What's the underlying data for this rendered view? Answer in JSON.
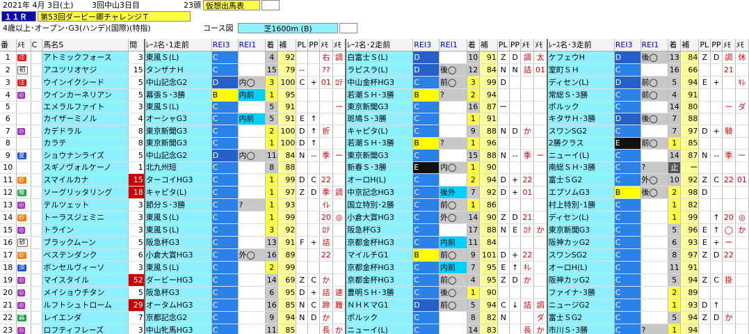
{
  "header": {
    "date": "2021年 4月 3日(土)",
    "meeting": "3回中山3日目",
    "race_no": "１１Ｒ",
    "race_name": "第53回ダービー卿チャレンジＴ",
    "field": "23頭",
    "mode": "仮想出馬表",
    "cond": "4歳以上･オープン･G3(ハンデ)(国際)(特指)",
    "course_label": "コース図",
    "course": "芝1600m (B)"
  },
  "columns": [
    "番",
    "ﾒﾓ",
    "C",
    "馬名S",
    "間",
    "ﾚｰｽ名･1走前",
    "REI3",
    "REI1",
    "着",
    "補",
    "PL",
    "PP",
    "ﾒﾓ",
    "ﾒﾓ",
    "ﾚｰｽ名･2走前",
    "REI3",
    "REI1",
    "着",
    "補",
    "PL",
    "PP",
    "ﾒﾓ",
    "ﾒﾓ",
    "ﾚｰｽ名･3走前",
    "REI3",
    "REI1",
    "着",
    "補",
    "PL",
    "PP",
    "ﾒﾓ",
    "ﾒﾓ"
  ],
  "colors": {
    "cyan": "#8ff0ff",
    "class_C": "#2a82e8",
    "class_B": "#ffff00",
    "red_mark": "#e00000"
  },
  "rows": [
    {
      "no": "1",
      "memo": "",
      "mk": "注",
      "mkc": "red",
      "name": "アトミックフォース",
      "iv": "3",
      "iv_hl": false,
      "r": [
        {
          "n": "東風Ｓ(L)",
          "g": "C",
          "s": "",
          "f": "4",
          "h": "92",
          "pl": "",
          "pp": "",
          "m1": "右",
          "m2": "調"
        },
        {
          "n": "白富士Ｓ(L)",
          "g": "D",
          "s": "",
          "f": "10",
          "h": "91",
          "pl": "Z",
          "pp": "D",
          "m1": "調",
          "m2": "太"
        },
        {
          "n": "ケフェウH",
          "g": "D",
          "s": "後◯",
          "f": "13",
          "h": "84",
          "pl": "Z",
          "pp": "D",
          "m1": "調",
          "m2": "休"
        }
      ]
    },
    {
      "no": "2",
      "memo": "",
      "mk": "初",
      "mkc": "wht",
      "name": "アユツリオヤジ",
      "iv": "15",
      "iv_hl": false,
      "r": [
        {
          "n": "タンザナＨ",
          "g": "C",
          "s": "",
          "f": "15",
          "h": "79",
          "pl": "--",
          "pp": "",
          "m1": "??",
          "m2": ""
        },
        {
          "n": "ラピスラ(L)",
          "g": "D",
          "s": "後◯",
          "f": "12",
          "h": "84",
          "pl": "N",
          "pp": "N",
          "m1": "詰",
          "m2": "01"
        },
        {
          "n": "室町ＳＨ",
          "g": "C",
          "s": "",
          "f": "16",
          "h": "66",
          "pl": "",
          "pp": "",
          "m1": "21",
          "m2": ""
        }
      ]
    },
    {
      "no": "3",
      "memo": "",
      "mk": "注",
      "mkc": "red",
      "name": "ウインイクシード",
      "iv": "5",
      "iv_hl": false,
      "r": [
        {
          "n": "中山記念G2",
          "g": "D",
          "s": "内◯",
          "f": "3",
          "h": "100",
          "pl": "C",
          "pp": "+",
          "m1": "01",
          "m2": "ﾛﾃ"
        },
        {
          "n": "中山金杯HG3",
          "g": "C",
          "s": "前◯",
          "f": "3",
          "h": "99",
          "pl": "D",
          "pp": "",
          "m1": "",
          "m2": ""
        },
        {
          "n": "ディセン(L)",
          "g": "D",
          "s": "前◯",
          "f": "5",
          "h": "94",
          "pl": "E",
          "pp": "+",
          "m1": "",
          "m2": "ｷﾚ"
        }
      ]
    },
    {
      "no": "4",
      "memo": "",
      "mk": "◎",
      "mkc": "pur",
      "name": "ウインカーネリアン",
      "iv": "5",
      "iv_hl": false,
      "r": [
        {
          "n": "幕張Ｓ･3勝",
          "g": "B",
          "s": "内前",
          "f": "1",
          "h": "95",
          "pl": "",
          "pp": "",
          "m1": "",
          "m2": ""
        },
        {
          "n": "若潮ＳＨ･3勝",
          "g": "B",
          "s": "?",
          "f": "2",
          "h": "94",
          "pl": "",
          "pp": "",
          "m1": "",
          "m2": ""
        },
        {
          "n": "常総Ｓ･3勝",
          "g": "C",
          "s": "前◯",
          "f": "4",
          "h": "91",
          "pl": "",
          "pp": "",
          "m1": "",
          "m2": ""
        }
      ]
    },
    {
      "no": "5",
      "memo": "",
      "mk": "",
      "mkc": "",
      "name": "エメラルファイト",
      "iv": "3",
      "iv_hl": false,
      "r": [
        {
          "n": "東風Ｓ(L)",
          "g": "C",
          "s": "",
          "f": "5",
          "h": "91",
          "pl": "",
          "pp": "",
          "m1": "",
          "m2": "ー"
        },
        {
          "n": "東京新聞G3",
          "g": "C",
          "s": "",
          "f": "16",
          "h": "87",
          "pl": "ー",
          "pp": "",
          "m1": "",
          "m2": ""
        },
        {
          "n": "ポルック",
          "g": "C",
          "s": "",
          "f": "14",
          "h": "80",
          "pl": "",
          "pp": "",
          "m1": "ー",
          "m2": "ダ"
        }
      ]
    },
    {
      "no": "6",
      "memo": "",
      "mk": "",
      "mkc": "",
      "name": "カイザーミノル",
      "iv": "4",
      "iv_hl": false,
      "r": [
        {
          "n": "オーシャG3",
          "g": "C",
          "s": "内前",
          "f": "5",
          "h": "91",
          "pl": "E",
          "pp": "↑",
          "m1": "",
          "m2": ""
        },
        {
          "n": "斑鳩Ｓ･3勝",
          "g": "C",
          "s": "",
          "f": "1",
          "h": "91",
          "pl": "",
          "pp": "",
          "m1": "",
          "m2": ""
        },
        {
          "n": "キタサＨ･3勝",
          "g": "D",
          "s": "後◯",
          "f": "7",
          "h": "88",
          "pl": "",
          "pp": "",
          "m1": "",
          "m2": ""
        }
      ]
    },
    {
      "no": "7",
      "memo": "",
      "mk": "◎",
      "mkc": "pur",
      "name": "カデドラル",
      "iv": "8",
      "iv_hl": false,
      "r": [
        {
          "n": "東京新聞G3",
          "g": "C",
          "s": "",
          "f": "2",
          "h": "100",
          "pl": "D",
          "pp": "↑",
          "m1": "折",
          "m2": ""
        },
        {
          "n": "キャピタ(L)",
          "g": "C",
          "s": "",
          "f": "9",
          "h": "88",
          "pl": "N",
          "pp": "D",
          "m1": "か",
          "m2": ""
        },
        {
          "n": "スワンSG2",
          "g": "C",
          "s": "",
          "f": "7",
          "h": "97",
          "pl": "D",
          "pp": "+",
          "m1": "騎",
          "m2": ""
        }
      ]
    },
    {
      "no": "8",
      "memo": "",
      "mk": "",
      "mkc": "",
      "name": "カラテ",
      "iv": "8",
      "iv_hl": false,
      "r": [
        {
          "n": "東京新聞G3",
          "g": "C",
          "s": "",
          "f": "1",
          "h": "100",
          "pl": "D",
          "pp": "↑",
          "m1": "",
          "m2": ""
        },
        {
          "n": "若潮ＳＨ･3勝",
          "g": "B",
          "s": "?",
          "f": "1",
          "h": "96",
          "pl": "",
          "pp": "",
          "m1": "",
          "m2": ""
        },
        {
          "n": "2勝クラス",
          "g": "E",
          "s": "前◯",
          "f": "1",
          "h": "85",
          "pl": "",
          "pp": "",
          "m1": "",
          "m2": ""
        }
      ]
    },
    {
      "no": "9",
      "memo": "",
      "mk": "夏",
      "mkc": "blu",
      "name": "ショウナンライズ",
      "iv": "5",
      "iv_hl": false,
      "r": [
        {
          "n": "中山記念G2",
          "g": "D",
          "s": "内◯",
          "f": "11",
          "h": "84",
          "pl": "N",
          "pp": "--",
          "m1": "季",
          "m2": "ー"
        },
        {
          "n": "東京新聞G3",
          "g": "C",
          "s": "",
          "f": "15",
          "h": "88",
          "pl": "N",
          "pp": "--",
          "m1": "季",
          "m2": "ー"
        },
        {
          "n": "ニューイ(L)",
          "g": "C",
          "s": "",
          "f": "14",
          "h": "87",
          "pl": "N",
          "pp": "--",
          "m1": "季",
          "m2": "ー"
        }
      ]
    },
    {
      "no": "10",
      "memo": "",
      "mk": "",
      "mkc": "",
      "name": "スギノヴォルケーノ",
      "iv": "1",
      "iv_hl": false,
      "r": [
        {
          "n": "北九州短",
          "g": "C",
          "s": "",
          "f": "8",
          "h": "88",
          "pl": "",
          "pp": "",
          "m1": "",
          "m2": ""
        },
        {
          "n": "新春Ｓ･3勝",
          "g": "E",
          "s": "内◯",
          "f": "1",
          "h": "90",
          "pl": "",
          "pp": "",
          "m1": "",
          "m2": ""
        },
        {
          "n": "南総ＳＨ･3勝",
          "g": "C",
          "s": "?",
          "f": "止",
          "h": "ー",
          "pl": "",
          "pp": "",
          "m1": "",
          "m2": ""
        }
      ]
    },
    {
      "no": "11",
      "memo": "",
      "mk": "砂",
      "mkc": "org",
      "name": "スマイルカナ",
      "iv": "15",
      "iv_hl": true,
      "r": [
        {
          "n": "ターコイHG3",
          "g": "C",
          "s": "",
          "f": "1",
          "h": "99",
          "pl": "D",
          "pp": "C",
          "m1": "22",
          "m2": ""
        },
        {
          "n": "オーロH(L)",
          "g": "C",
          "s": "",
          "f": "2",
          "h": "94",
          "pl": "D",
          "pp": "+",
          "m1": "22",
          "m2": ""
        },
        {
          "n": "富士ＳG2",
          "g": "C",
          "s": "外◯",
          "f": "10",
          "h": "92",
          "pl": "Z",
          "pp": "C",
          "m1": "22",
          "m2": "01"
        }
      ]
    },
    {
      "no": "12",
      "memo": "",
      "mk": "暖",
      "mkc": "grn",
      "name": "ソーグリッタリング",
      "iv": "18",
      "iv_hl": true,
      "r": [
        {
          "n": "キャピタ(L)",
          "g": "C",
          "s": "",
          "f": "1",
          "h": "97",
          "pl": "Z",
          "pp": "D",
          "m1": "季",
          "m2": "調"
        },
        {
          "n": "中京記念HG3",
          "g": "C",
          "s": "後外",
          "f": "7",
          "h": "92",
          "pl": "D",
          "pp": "+",
          "m1": "01",
          "m2": ""
        },
        {
          "n": "エプソムG3",
          "g": "B",
          "s": "後◯",
          "f": "2",
          "h": "98",
          "pl": "D",
          "pp": "",
          "m1": "",
          "m2": ""
        }
      ]
    },
    {
      "no": "13",
      "memo": "",
      "mk": "◎",
      "mkc": "pur",
      "name": "テルツェット",
      "iv": "3",
      "iv_hl": false,
      "r": [
        {
          "n": "節分Ｓ･3勝",
          "g": "C",
          "s": "?",
          "f": "1",
          "h": "93",
          "pl": "",
          "pp": "",
          "m1": "ｲﾚ",
          "m2": ""
        },
        {
          "n": "国立特別･2勝",
          "g": "C",
          "s": "前◯",
          "f": "1",
          "h": "86",
          "pl": "",
          "pp": "",
          "m1": "",
          "m2": ""
        },
        {
          "n": "村上特別･1勝",
          "g": "C",
          "s": "",
          "f": "1",
          "h": "82",
          "pl": "",
          "pp": "",
          "m1": "",
          "m2": ""
        }
      ]
    },
    {
      "no": "14",
      "memo": "",
      "mk": "砂",
      "mkc": "org",
      "name": "トーラスジェミニ",
      "iv": "3",
      "iv_hl": false,
      "r": [
        {
          "n": "東風Ｓ(L)",
          "g": "C",
          "s": "",
          "f": "1",
          "h": "99",
          "pl": "",
          "pp": "",
          "m1": "20",
          "m2": "◎"
        },
        {
          "n": "小倉大賞HG3",
          "g": "C",
          "s": "外◯",
          "f": "14",
          "h": "90",
          "pl": "Z",
          "pp": "D",
          "m1": "21",
          "m2": ""
        },
        {
          "n": "ディセン(L)",
          "g": "C",
          "s": "",
          "f": "1",
          "h": "99",
          "pl": "",
          "pp": "↑",
          "m1": "20",
          "m2": "◎"
        }
      ]
    },
    {
      "no": "15",
      "memo": "",
      "mk": "◎",
      "mkc": "pur",
      "name": "トライン",
      "iv": "3",
      "iv_hl": false,
      "r": [
        {
          "n": "東風Ｓ(L)",
          "g": "C",
          "s": "",
          "f": "3",
          "h": "92",
          "pl": "",
          "pp": "",
          "m1": "ﾛﾃ",
          "m2": ""
        },
        {
          "n": "阪急杯G3",
          "g": "C",
          "s": "",
          "f": "17",
          "h": "88",
          "pl": "N",
          "pp": "E",
          "m1": "ﾛﾃ",
          "m2": "か"
        },
        {
          "n": "東京新聞G3",
          "g": "C",
          "s": "",
          "f": "5",
          "h": "96",
          "pl": "E",
          "pp": "↑",
          "m1": "◯",
          "m2": "か"
        }
      ]
    },
    {
      "no": "16",
      "memo": "",
      "mk": "砂",
      "mkc": "wht",
      "name": "ブラックムーン",
      "iv": "5",
      "iv_hl": false,
      "r": [
        {
          "n": "阪急杯G3",
          "g": "C",
          "s": "",
          "f": "13",
          "h": "91",
          "pl": "F",
          "pp": "+",
          "m1": "詰",
          "m2": ""
        },
        {
          "n": "京都金杯HG3",
          "g": "C",
          "s": "内前",
          "f": "11",
          "h": "84",
          "pl": "",
          "pp": "",
          "m1": "",
          "m2": ""
        },
        {
          "n": "阪神カッG2",
          "g": "C",
          "s": "",
          "f": "6",
          "h": "93",
          "pl": "E",
          "pp": "+",
          "m1": "ー",
          "m2": ""
        }
      ]
    },
    {
      "no": "17",
      "memo": "",
      "mk": "砂",
      "mkc": "org",
      "name": "ベステンダンク",
      "iv": "6",
      "iv_hl": false,
      "r": [
        {
          "n": "小倉大賞HG3",
          "g": "C",
          "s": "外◯",
          "f": "16",
          "h": "89",
          "pl": "",
          "pp": "",
          "m1": "22",
          "m2": ""
        },
        {
          "n": "マイルチG1",
          "g": "B",
          "s": "前◯",
          "f": "9",
          "h": "101",
          "pl": "D",
          "pp": "+",
          "m1": "22",
          "m2": ""
        },
        {
          "n": "スワンSG2",
          "g": "C",
          "s": "",
          "f": "8",
          "h": "97",
          "pl": "Z",
          "pp": "D",
          "m1": "22",
          "m2": ""
        }
      ]
    },
    {
      "no": "18",
      "memo": "",
      "mk": "涼",
      "mkc": "blu",
      "name": "ボンセルヴィーソ",
      "iv": "3",
      "iv_hl": false,
      "r": [
        {
          "n": "東風Ｓ(L)",
          "g": "C",
          "s": "",
          "f": "2",
          "h": "99",
          "pl": "",
          "pp": "",
          "m1": "",
          "m2": ""
        },
        {
          "n": "京都金杯HG3",
          "g": "C",
          "s": "内前",
          "f": "7",
          "h": "95",
          "pl": "E",
          "pp": "↑",
          "m1": "ｷﾚ",
          "m2": ""
        },
        {
          "n": "オーロH(L)",
          "g": "C",
          "s": "",
          "f": "11",
          "h": "91",
          "pl": "",
          "pp": "",
          "m1": "",
          "m2": ""
        }
      ]
    },
    {
      "no": "19",
      "memo": "",
      "mk": "◎",
      "mkc": "pur",
      "name": "マイスタイル",
      "iv": "52",
      "iv_hl": true,
      "r": [
        {
          "n": "ダービーHG3",
          "g": "C",
          "s": "",
          "f": "14",
          "h": "69",
          "pl": "Z",
          "pp": "C",
          "m1": "か",
          "m2": ""
        },
        {
          "n": "京都金杯HG3",
          "g": "C",
          "s": "前◯",
          "f": "4",
          "h": "95",
          "pl": "Z",
          "pp": "D",
          "m1": "か",
          "m2": ""
        },
        {
          "n": "阪神カッG2",
          "g": "C",
          "s": "",
          "f": "5",
          "h": "94",
          "pl": "Z",
          "pp": "C",
          "m1": "掛",
          "m2": ""
        }
      ]
    },
    {
      "no": "20",
      "memo": "",
      "mk": "◎",
      "mkc": "pur",
      "name": "メイショウチタン",
      "iv": "5",
      "iv_hl": false,
      "r": [
        {
          "n": "阪急杯G3",
          "g": "C",
          "s": "",
          "f": "6",
          "h": "95",
          "pl": "D",
          "pp": "+",
          "m1": "詰",
          "m2": "速"
        },
        {
          "n": "豊明ＳＨ･3勝",
          "g": "C",
          "s": "後◯",
          "f": "1",
          "h": "90",
          "pl": "",
          "pp": "",
          "m1": "",
          "m2": ""
        },
        {
          "n": "ファイナ･3勝",
          "g": "C",
          "s": "",
          "f": "2",
          "h": "89",
          "pl": "",
          "pp": "",
          "m1": "",
          "m2": ""
        }
      ]
    },
    {
      "no": "21",
      "memo": "",
      "mk": "◎",
      "mkc": "pur",
      "name": "ルフトシュトローム",
      "iv": "29",
      "iv_hl": true,
      "r": [
        {
          "n": "オータムHG3",
          "g": "C",
          "s": "",
          "f": "16",
          "h": "85",
          "pl": "N",
          "pp": "C",
          "m1": "蹄",
          "m2": "難"
        },
        {
          "n": "ＮＨＫマG1",
          "g": "D",
          "s": "前◯",
          "f": "5",
          "h": "94",
          "pl": "C",
          "pp": "↓",
          "m1": "詰",
          "m2": "調"
        },
        {
          "n": "ニュージG2",
          "g": "C",
          "s": "",
          "f": "1",
          "h": "93",
          "pl": "D",
          "pp": "↑",
          "m1": "",
          "m2": ""
        }
      ]
    },
    {
      "no": "22",
      "memo": "",
      "mk": "晨",
      "mkc": "grn",
      "name": "レイエンダ",
      "iv": "7",
      "iv_hl": false,
      "r": [
        {
          "n": "京都記念G2",
          "g": "C",
          "s": "",
          "f": "9",
          "h": "94",
          "pl": "N",
          "pp": "D",
          "m1": "か",
          "m2": ""
        },
        {
          "n": "ポルック",
          "g": "C",
          "s": "",
          "f": "8",
          "h": "82",
          "pl": "N",
          "pp": "",
          "m1": "",
          "m2": "ダ"
        },
        {
          "n": "富士ＳG2",
          "g": "C",
          "s": "",
          "f": "5",
          "h": "94",
          "pl": "Z",
          "pp": "D",
          "m1": "か",
          "m2": ""
        }
      ]
    },
    {
      "no": "23",
      "memo": "",
      "mk": "◎",
      "mkc": "pur",
      "name": "ロフティフレーズ",
      "iv": "3",
      "iv_hl": false,
      "r": [
        {
          "n": "中山牝馬HG3",
          "g": "C",
          "s": "",
          "f": "11",
          "h": "85",
          "pl": "",
          "pp": "",
          "m1": "長",
          "m2": "か"
        },
        {
          "n": "ニューイ(L)",
          "g": "C",
          "s": "",
          "f": "14",
          "h": "83",
          "pl": "",
          "pp": "",
          "m1": "長",
          "m2": "か"
        },
        {
          "n": "市川Ｓ･3勝",
          "g": "C",
          "s": "?",
          "f": "1",
          "h": "94",
          "pl": "",
          "pp": "",
          "m1": "",
          "m2": ""
        }
      ]
    }
  ]
}
